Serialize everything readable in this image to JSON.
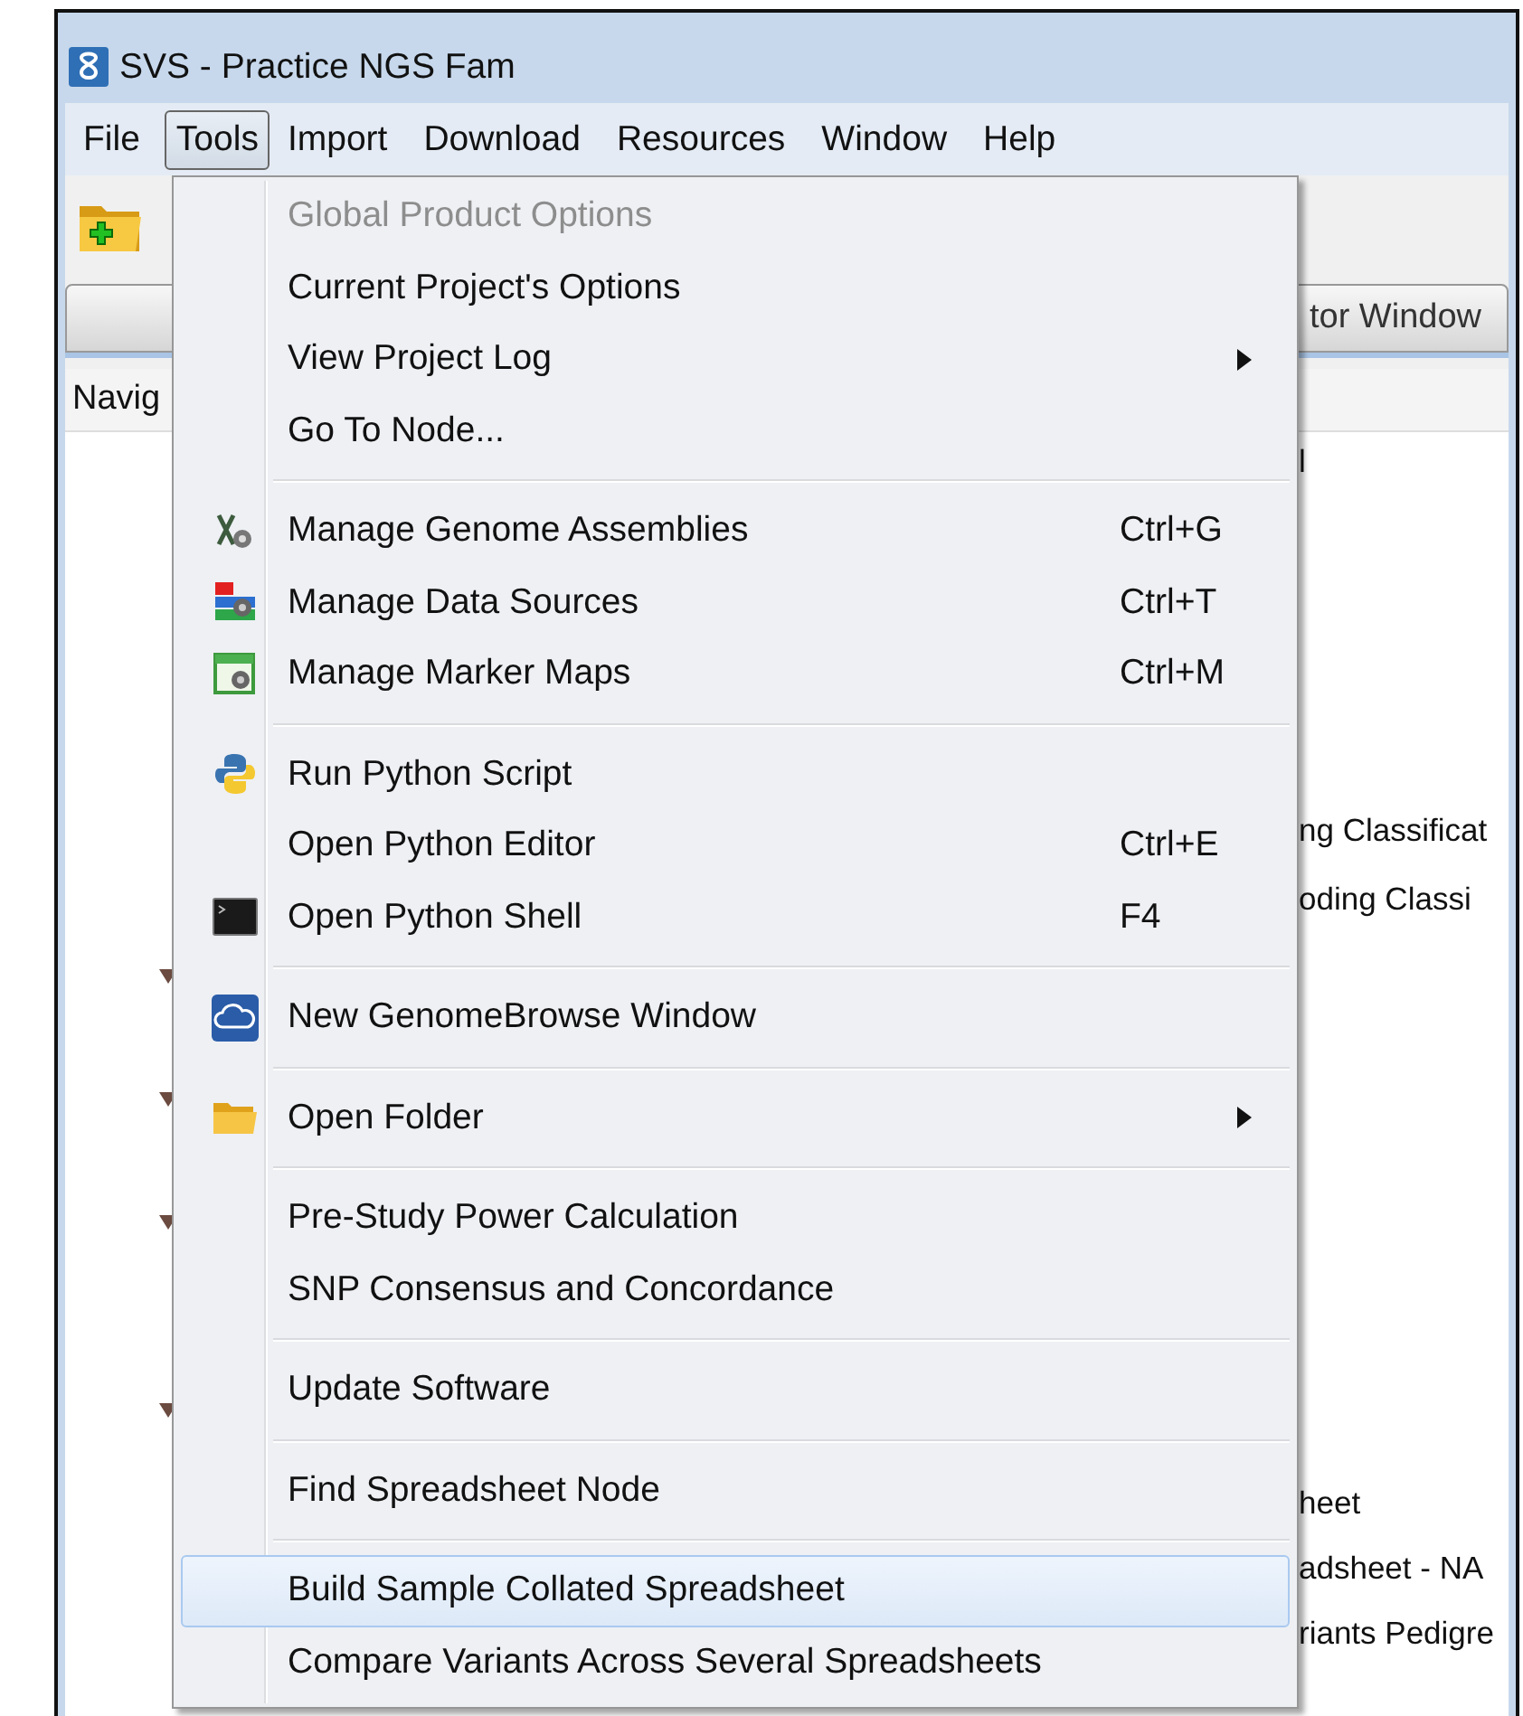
{
  "window": {
    "title": "SVS - Practice NGS Fam"
  },
  "menu_bar": [
    {
      "label": "File",
      "selected": false
    },
    {
      "label": "Tools",
      "selected": true
    },
    {
      "label": "Import",
      "selected": false
    },
    {
      "label": "Download",
      "selected": false
    },
    {
      "label": "Resources",
      "selected": false
    },
    {
      "label": "Window",
      "selected": false
    },
    {
      "label": "Help",
      "selected": false
    }
  ],
  "tab_bar": {
    "tab_label": "tor Window"
  },
  "navigator": {
    "header": "Navig",
    "rows": [
      "l",
      "ng Classificat",
      "oding Classi",
      "heet",
      "adsheet - NA",
      "riants Pedigre"
    ]
  },
  "tools_menu": {
    "groups": [
      {
        "items": [
          {
            "label": "Global Product Options",
            "disabled": true,
            "submenu": false,
            "selected": false
          },
          {
            "label": "Current Project's Options",
            "disabled": false,
            "submenu": false,
            "selected": false
          },
          {
            "label": "View Project Log",
            "disabled": false,
            "submenu": true,
            "selected": false
          },
          {
            "label": "Go To Node...",
            "disabled": false,
            "submenu": false,
            "selected": false
          }
        ]
      },
      {
        "items": [
          {
            "label": "Manage Genome Assemblies",
            "shortcut": "Ctrl+G",
            "kind": "genome",
            "disabled": false,
            "submenu": false,
            "selected": false
          },
          {
            "label": "Manage Data Sources",
            "shortcut": "Ctrl+T",
            "kind": "datasources",
            "disabled": false,
            "submenu": false,
            "selected": false
          },
          {
            "label": "Manage Marker Maps",
            "shortcut": "Ctrl+M",
            "kind": "markermaps",
            "disabled": false,
            "submenu": false,
            "selected": false
          }
        ]
      },
      {
        "items": [
          {
            "label": "Run Python Script",
            "kind": "python",
            "disabled": false,
            "submenu": false,
            "selected": false
          },
          {
            "label": "Open Python Editor",
            "shortcut": "Ctrl+E",
            "disabled": false,
            "submenu": false,
            "selected": false
          },
          {
            "label": "Open Python Shell",
            "shortcut": "F4",
            "kind": "terminal",
            "disabled": false,
            "submenu": false,
            "selected": false
          }
        ]
      },
      {
        "items": [
          {
            "label": "New GenomeBrowse Window",
            "kind": "browse",
            "disabled": false,
            "submenu": false,
            "selected": false
          }
        ]
      },
      {
        "items": [
          {
            "label": "Open Folder",
            "kind": "folder",
            "disabled": false,
            "submenu": true,
            "selected": false
          }
        ]
      },
      {
        "items": [
          {
            "label": "Pre-Study Power Calculation",
            "disabled": false,
            "submenu": false,
            "selected": false
          },
          {
            "label": "SNP Consensus and Concordance",
            "disabled": false,
            "submenu": false,
            "selected": false
          }
        ]
      },
      {
        "items": [
          {
            "label": "Update Software",
            "disabled": false,
            "submenu": false,
            "selected": false
          }
        ]
      },
      {
        "items": [
          {
            "label": "Find Spreadsheet Node",
            "disabled": false,
            "submenu": false,
            "selected": false
          }
        ]
      },
      {
        "items": [
          {
            "label": "Build Sample Collated Spreadsheet",
            "disabled": false,
            "submenu": false,
            "selected": true
          },
          {
            "label": "Compare Variants Across Several Spreadsheets",
            "disabled": false,
            "submenu": false,
            "selected": false
          }
        ]
      }
    ]
  }
}
